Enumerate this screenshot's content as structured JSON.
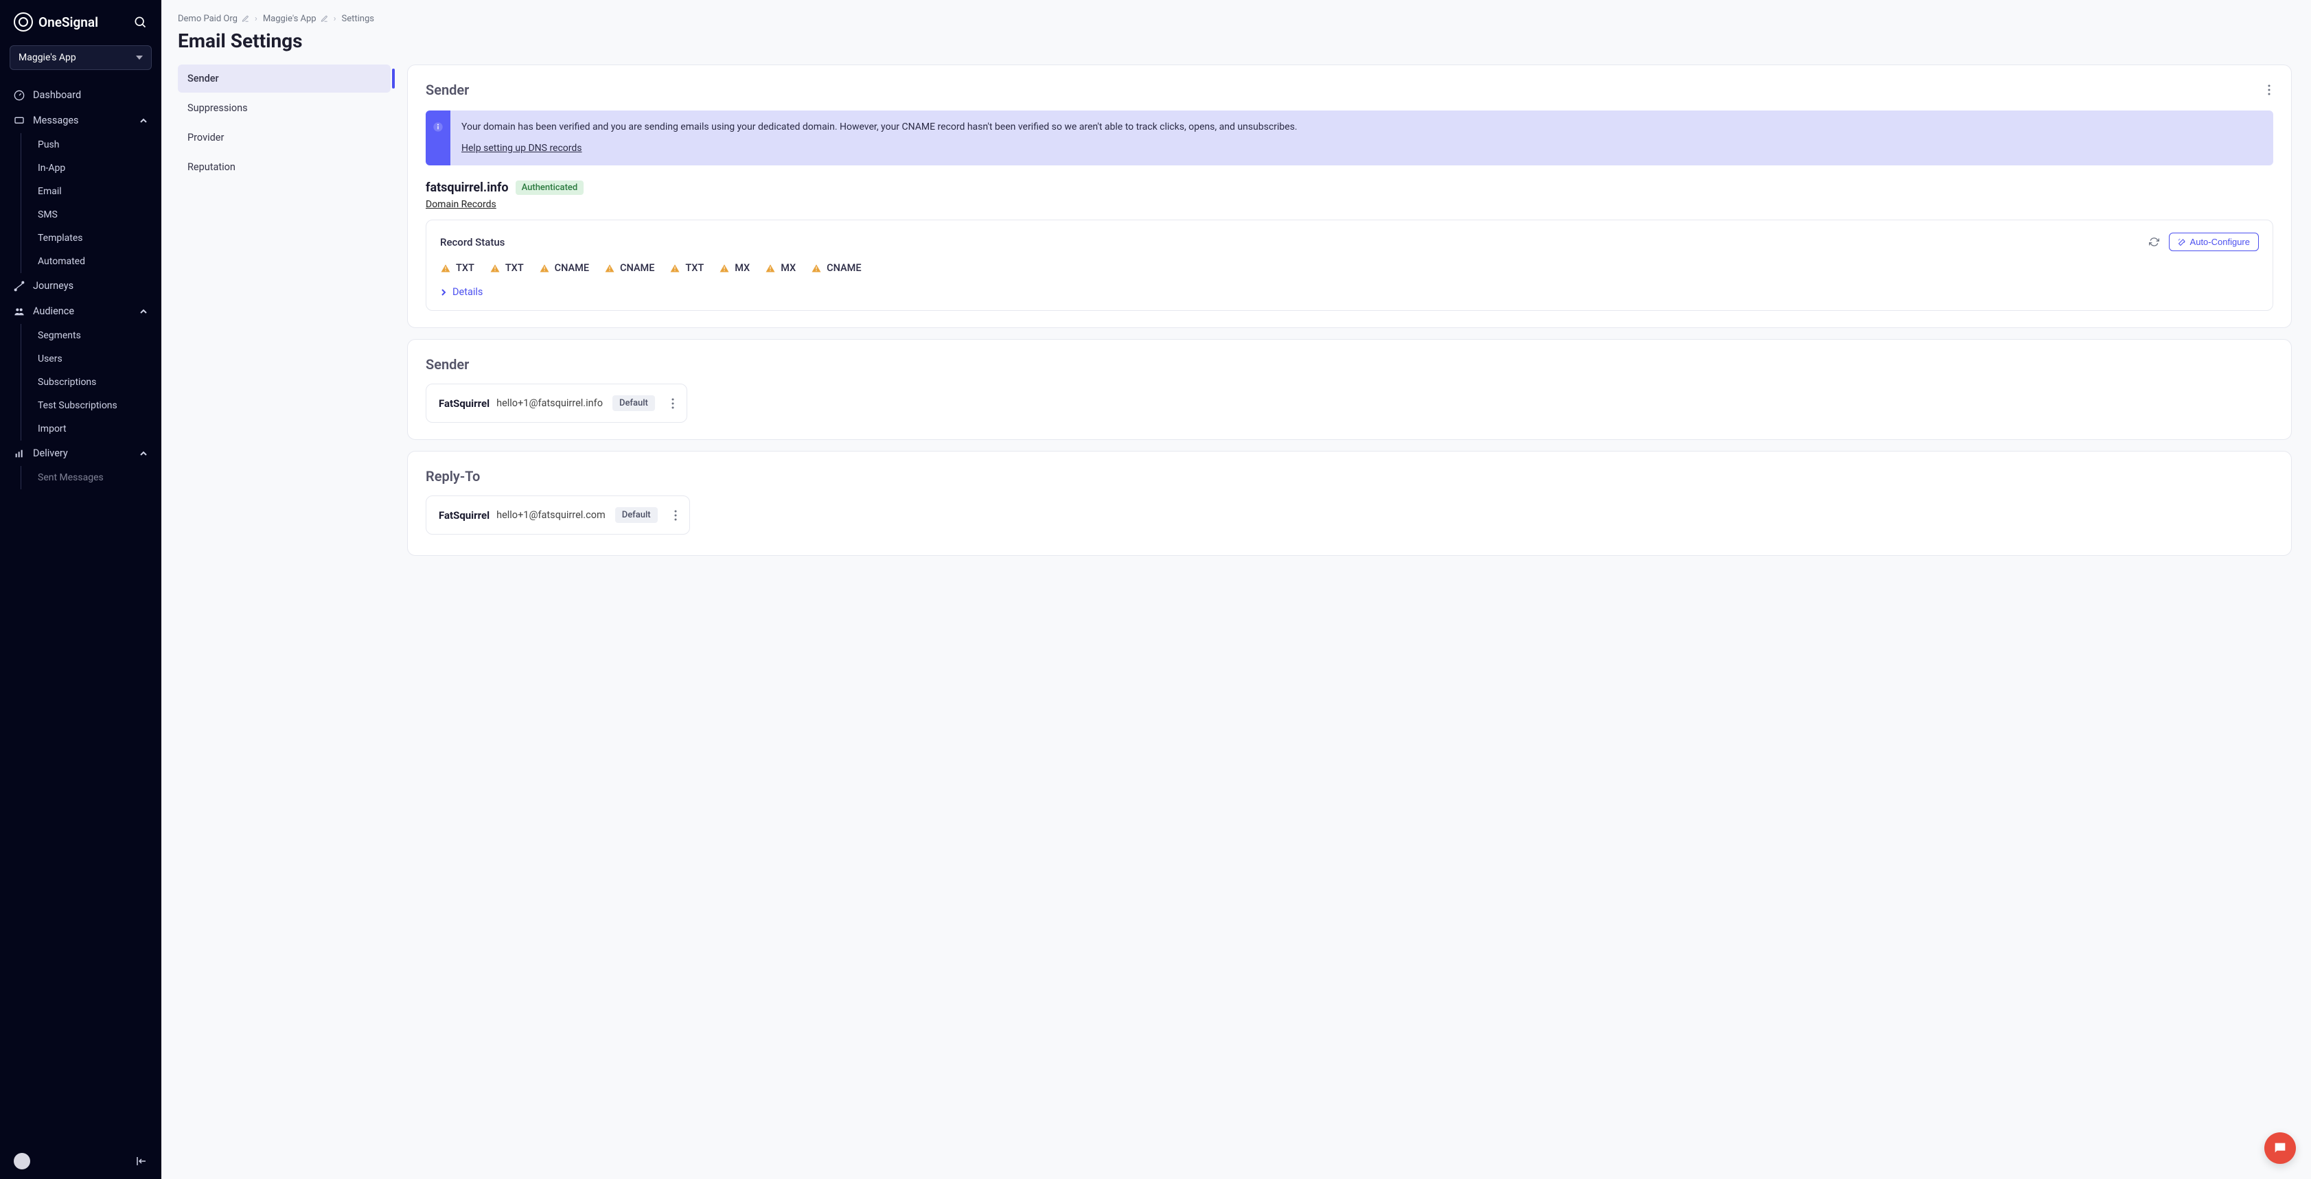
{
  "brand": {
    "name": "OneSignal"
  },
  "app_selector": {
    "current": "Maggie's App"
  },
  "sidebar": {
    "dashboard": "Dashboard",
    "messages": {
      "label": "Messages",
      "push": "Push",
      "inapp": "In-App",
      "email": "Email",
      "sms": "SMS",
      "templates": "Templates",
      "automated": "Automated"
    },
    "journeys": "Journeys",
    "audience": {
      "label": "Audience",
      "segments": "Segments",
      "users": "Users",
      "subscriptions": "Subscriptions",
      "test_subscriptions": "Test Subscriptions",
      "import": "Import"
    },
    "delivery": {
      "label": "Delivery",
      "sent_messages": "Sent Messages"
    }
  },
  "breadcrumbs": {
    "org": "Demo Paid Org",
    "app": "Maggie's App",
    "page": "Settings"
  },
  "page_title": "Email Settings",
  "tabs": {
    "sender": "Sender",
    "suppressions": "Suppressions",
    "provider": "Provider",
    "reputation": "Reputation"
  },
  "sender_section": {
    "title": "Sender",
    "alert_text": "Your domain has been verified and you are sending emails using your dedicated domain. However, your CNAME record hasn't been verified so we aren't able to track clicks, opens, and unsubscribes.",
    "alert_link": "Help setting up DNS records",
    "domain": "fatsquirrel.info",
    "auth_badge": "Authenticated",
    "domain_records_link": "Domain Records",
    "record_status_label": "Record Status",
    "auto_configure": "Auto-Configure",
    "records": [
      "TXT",
      "TXT",
      "CNAME",
      "CNAME",
      "TXT",
      "MX",
      "MX",
      "CNAME"
    ],
    "details_label": "Details"
  },
  "sender_entry": {
    "title": "Sender",
    "name": "FatSquirrel",
    "email": "hello+1@fatsquirrel.info",
    "tag": "Default"
  },
  "reply_to": {
    "title": "Reply-To",
    "name": "FatSquirrel",
    "email": "hello+1@fatsquirrel.com",
    "tag": "Default"
  }
}
